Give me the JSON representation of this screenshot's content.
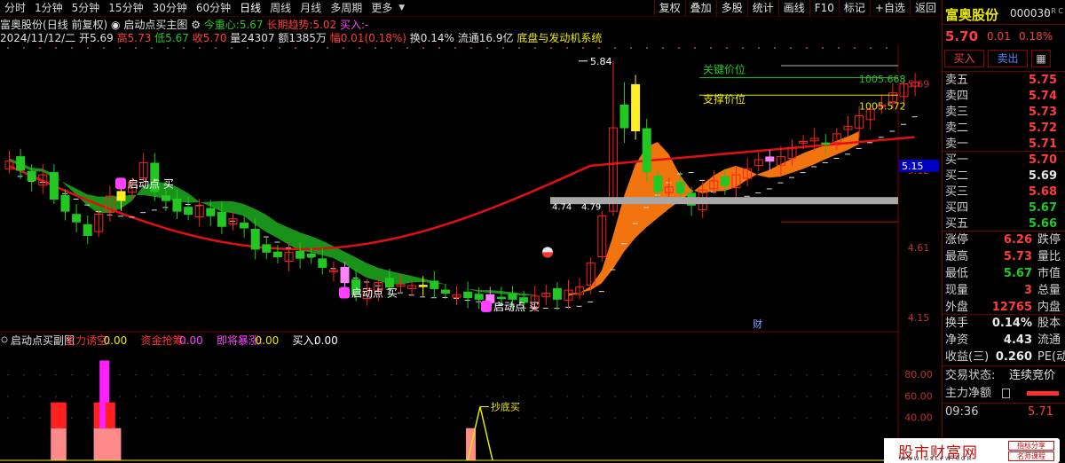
{
  "toolbar": {
    "tabs": [
      "分时",
      "1分钟",
      "5分钟",
      "15分钟",
      "30分钟",
      "60分钟",
      "日线",
      "周线",
      "月线",
      "多周期",
      "更多"
    ],
    "active_tab": "日线",
    "tools": [
      "复权",
      "叠加",
      "多股",
      "统计",
      "画线",
      "F10",
      "标记",
      "+自选",
      "返回"
    ]
  },
  "header": {
    "stock_name": "富奥股份",
    "period": "(日线 前复权)",
    "indicator_name": "启动点买主图",
    "jzx_label": "今重心:",
    "jzx_value": "5.67",
    "trend_label": "长期趋势:",
    "trend_value": "5.02",
    "buy_label": "买入:",
    "buy_value": "-"
  },
  "ohlc": {
    "date": "2024/11/12/二",
    "open_label": "开",
    "open": "5.69",
    "high_label": "高",
    "high": "5.73",
    "low_label": "低",
    "low": "5.67",
    "close_label": "收",
    "close": "5.70",
    "vol_label": "量",
    "vol": "24307",
    "amount_label": "额",
    "amount": "1385万",
    "range_label": "幅",
    "range": "0.01(0.18%)",
    "turnover_label": "换",
    "turnover": "0.14%",
    "float_label": "流通",
    "float": "16.9亿",
    "concept": "底盘与发动机系统"
  },
  "main_chart": {
    "y_axis": [
      "5.69",
      "5.12",
      "4.61",
      "4.15"
    ],
    "cur_price_tag": "5.15",
    "peak_label": "5.84",
    "low_label_a": "4.74",
    "low_label_b": "4.79",
    "key_price_label": "关键价位",
    "key_price_value": "1005.668",
    "support_label": "支撑价位",
    "support_value": "1005.572",
    "buy_signal_text": "启动点 买",
    "finance_tag": "财",
    "colors": {
      "up": "#ff2020",
      "down": "#22c722",
      "band_green": "#1a9a1a",
      "band_orange": "#ff7a10",
      "ma_red": "#e01010"
    }
  },
  "sub_chart": {
    "title": "启动点买副图",
    "f1_label": "主力诱空:",
    "f1_value": "0.00",
    "f2_label": "资金抢筹:",
    "f2_value": "0.00",
    "f3_label": "即将暴涨:",
    "f3_value": "0.00",
    "f4_label": "买入:",
    "f4_value": "0.00",
    "y_axis": [
      "80.00",
      "60.00",
      "40.00"
    ],
    "bottom_label": "抄底买",
    "bars": [
      {
        "pos": 0.2,
        "pink": 30,
        "red": 24,
        "mag": 0
      },
      {
        "pos": 0.8,
        "pink": 30,
        "red": 24,
        "mag": 0
      },
      {
        "pos": 4.6,
        "pink": 30,
        "red": 24,
        "mag": 0
      },
      {
        "pos": 5.2,
        "pink": 30,
        "red": 24,
        "mag": 63
      },
      {
        "pos": 5.8,
        "pink": 30,
        "red": 24,
        "mag": 0
      },
      {
        "pos": 6.4,
        "pink": 30,
        "red": 0,
        "mag": 0
      }
    ]
  },
  "quote": {
    "name": "富奥股份",
    "code": "000030",
    "lrc": "L R C",
    "price": "5.70",
    "change": "0.01",
    "pct": "0.18%",
    "buy_btn": "买入",
    "sell_btn": "卖出",
    "asks": [
      {
        "label": "卖五",
        "price": "5.75"
      },
      {
        "label": "卖四",
        "price": "5.74"
      },
      {
        "label": "卖三",
        "price": "5.73"
      },
      {
        "label": "卖二",
        "price": "5.72"
      },
      {
        "label": "卖一",
        "price": "5.71"
      }
    ],
    "bids": [
      {
        "label": "买一",
        "price": "5.70"
      },
      {
        "label": "买二",
        "price": "5.69"
      },
      {
        "label": "买三",
        "price": "5.68"
      },
      {
        "label": "买四",
        "price": "5.67"
      },
      {
        "label": "买五",
        "price": "5.66"
      }
    ],
    "stats": [
      {
        "label": "涨停",
        "value": "6.26",
        "label2": "跌停"
      },
      {
        "label": "最高",
        "value": "5.73",
        "label2": "量比"
      },
      {
        "label": "最低",
        "value": "5.67",
        "label2": "市值"
      },
      {
        "label": "现量",
        "value": "3",
        "label2": "总量"
      },
      {
        "label": "外盘",
        "value": "12765",
        "label2": "内盘"
      }
    ],
    "stats2": [
      {
        "label": "换手",
        "value": "0.14%",
        "label2": "股本"
      },
      {
        "label": "净资",
        "value": "4.43",
        "label2": "流通"
      },
      {
        "label": "收益(三)",
        "value": "0.260",
        "label2": "PE(动"
      }
    ],
    "trade_status_label": "交易状态:",
    "trade_status": "连续竞价",
    "main_net_label": "主力净额",
    "tick_time": "09:36",
    "tick_price": "5.71"
  },
  "watermark": {
    "brand": "股市财富网",
    "url": "W W W . G S C F W . C O M",
    "tag1": "指标分享",
    "tag2": "名师课程"
  }
}
